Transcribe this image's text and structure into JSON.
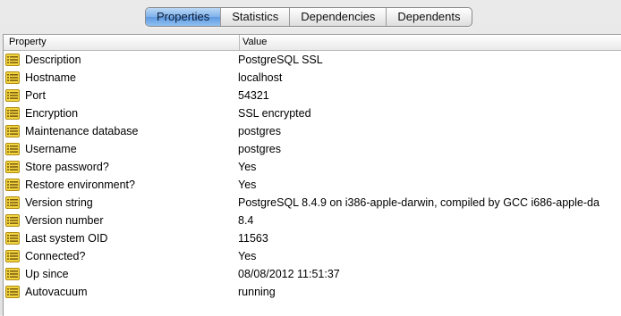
{
  "tabs": [
    {
      "label": "Properties",
      "active": true
    },
    {
      "label": "Statistics",
      "active": false
    },
    {
      "label": "Dependencies",
      "active": false
    },
    {
      "label": "Dependents",
      "active": false
    }
  ],
  "table": {
    "columns": [
      "Property",
      "Value"
    ],
    "row_icon": "property-list-icon",
    "rows": [
      {
        "property": "Description",
        "value": "PostgreSQL SSL"
      },
      {
        "property": "Hostname",
        "value": "localhost"
      },
      {
        "property": "Port",
        "value": "54321"
      },
      {
        "property": "Encryption",
        "value": "SSL encrypted"
      },
      {
        "property": "Maintenance database",
        "value": "postgres"
      },
      {
        "property": "Username",
        "value": "postgres"
      },
      {
        "property": "Store password?",
        "value": "Yes"
      },
      {
        "property": "Restore environment?",
        "value": "Yes"
      },
      {
        "property": "Version string",
        "value": "PostgreSQL 8.4.9 on i386-apple-darwin, compiled by GCC i686-apple-da"
      },
      {
        "property": "Version number",
        "value": "8.4"
      },
      {
        "property": "Last system OID",
        "value": "11563"
      },
      {
        "property": "Connected?",
        "value": "Yes"
      },
      {
        "property": "Up since",
        "value": "08/08/2012 11:51:37"
      },
      {
        "property": "Autovacuum",
        "value": "running"
      }
    ]
  },
  "colors": {
    "active_tab": "#6fa8e8",
    "icon_yellow": "#f2d640",
    "icon_lines": "#7a5a10"
  }
}
